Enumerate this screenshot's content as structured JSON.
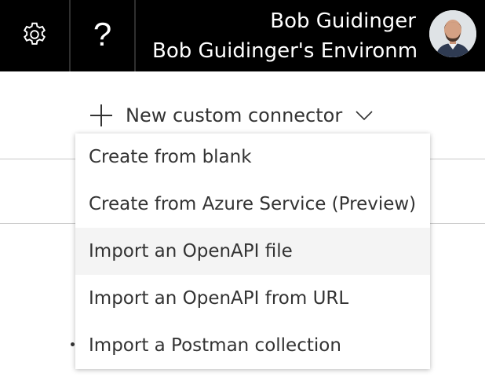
{
  "header": {
    "settings_icon": "gear-icon",
    "help_label": "?",
    "user_name": "Bob Guidinger",
    "environment": "Bob Guidinger's Environme",
    "avatar_icon": "user-avatar"
  },
  "toolbar": {
    "new_connector_label": "New custom connector",
    "add_icon": "plus-icon",
    "expand_icon": "chevron-down-icon"
  },
  "menu": {
    "items": [
      {
        "label": "Create from blank"
      },
      {
        "label": "Create from Azure Service (Preview)"
      },
      {
        "label": "Import an OpenAPI file",
        "state": "hovered"
      },
      {
        "label": "Import an OpenAPI from URL"
      },
      {
        "label": "Import a Postman collection"
      }
    ]
  },
  "colors": {
    "header_bg": "#000000",
    "header_text": "#ffffff",
    "text": "#333333",
    "hover_bg": "#f4f4f4"
  }
}
